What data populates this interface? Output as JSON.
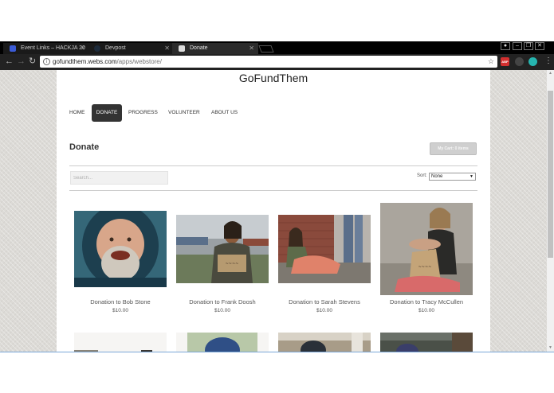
{
  "browser": {
    "tabs": [
      {
        "label": "Event Links – HACKJA 20",
        "favicon_color": "#3b5bd6"
      },
      {
        "label": "Devpost",
        "favicon_color": "#1c2a3a"
      },
      {
        "label": "Donate",
        "favicon_color": "#dddddd"
      }
    ],
    "url_host": "gofundthem.webs.com",
    "url_path": "/apps/webstore/",
    "extensions": [
      "ABP",
      "drive",
      "circle"
    ]
  },
  "site": {
    "title": "GoFundThem",
    "nav": [
      "HOME",
      "DONATE",
      "PROGRESS",
      "VOLUNTEER",
      "ABOUT US"
    ],
    "active_nav": "DONATE",
    "heading": "Donate",
    "cart_label": "My Cart: 0 items",
    "search_placeholder": "Search...",
    "sort_label": "Sort:",
    "sort_value": "None"
  },
  "products": [
    {
      "name": "Donation to Bob Stone",
      "price": "$10.00",
      "icon": "photo-bearded-man"
    },
    {
      "name": "Donation to Frank Doosh",
      "price": "$10.00",
      "icon": "photo-man-with-sign"
    },
    {
      "name": "Donation to Sarah Stevens",
      "price": "$10.00",
      "icon": "photo-woman-sitting"
    },
    {
      "name": "Donation to Tracy McCullen",
      "price": "$10.00",
      "icon": "photo-woman-with-sign"
    }
  ],
  "colors": {
    "nav_active_bg": "#333333",
    "page_background": "#dcdad6",
    "chrome": "#000000"
  }
}
